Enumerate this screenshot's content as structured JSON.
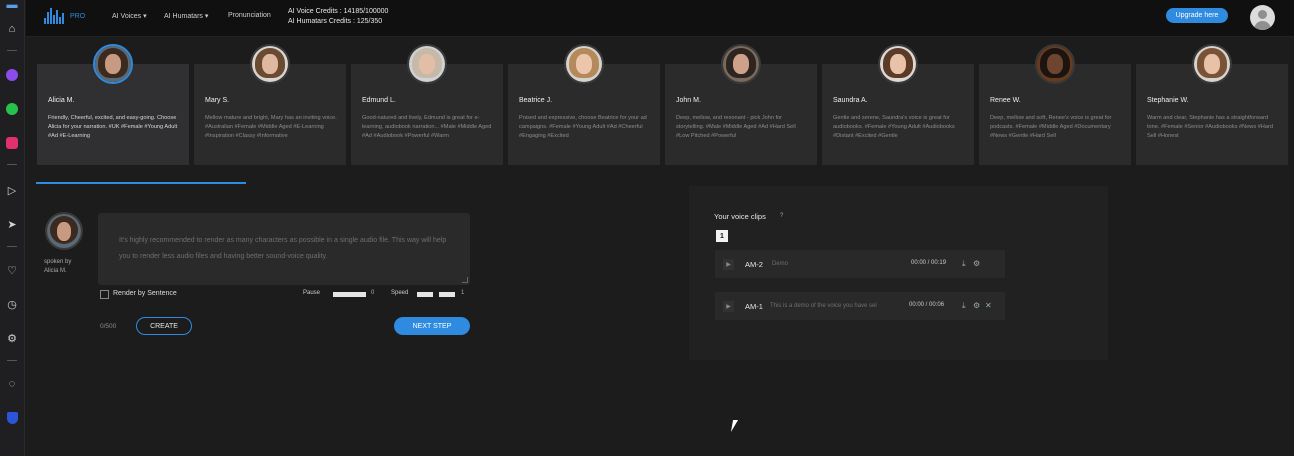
{
  "dock": {
    "icons": [
      "home-icon",
      "messenger-icon",
      "whatsapp-icon",
      "instagram-icon",
      "play-circle-icon",
      "send-icon",
      "heart-icon",
      "clock-icon",
      "gear-icon",
      "lightbulb-icon",
      "shield-icon"
    ]
  },
  "header": {
    "logo_text": "PRO",
    "nav": [
      "AI Voices ▾",
      "AI Humatars ▾",
      "Pronunciation"
    ],
    "credits": {
      "voice": "AI Voice Credits : 14185/100000",
      "humatars": "AI Humatars Credits : 125/350"
    },
    "upgrade_label": "Upgrade here"
  },
  "voices": [
    {
      "name": "Alicia M.",
      "desc": "Friendly, Cheerful, excited, and easy-going. Choose Alicia for your narration. #UK #Female #Young Adult #Ad #E-Learning",
      "selected": true
    },
    {
      "name": "Mary S.",
      "desc": "Mellow mature and bright, Mary has an inviting voice. #Australian #Female #Middle Aged #E-Learning #Inspiration #Classy #Informative",
      "selected": false
    },
    {
      "name": "Edmund L.",
      "desc": "Good-natured and lively, Edmund is great for e-learning, audiobook narration... #Male #Middle Aged #Ad #Audiobook #Powerful #Warm",
      "selected": false
    },
    {
      "name": "Beatrice J.",
      "desc": "Poised and expressive, choose Beatrice for your ad campaigns. #Female #Young Adult #Ad #Cheerful #Engaging #Excited",
      "selected": false
    },
    {
      "name": "John M.",
      "desc": "Deep, mellow, and resonant - pick John for storytelling. #Male #Middle Aged #Ad #Hard Sell #Low Pitched #Powerful",
      "selected": false
    },
    {
      "name": "Saundra A.",
      "desc": "Gentle and serene, Saundra's voice is great for audiobooks. #Female #Young Adult #Audiobooks #Distant #Excited #Gentle",
      "selected": false
    },
    {
      "name": "Renee W.",
      "desc": "Deep, mellow and soft, Renee's voice is great for podcasts. #Female #Middle Aged #Documentary #News #Gentle #Hard Sell",
      "selected": false
    },
    {
      "name": "Stephanie W.",
      "desc": "Warm and clear, Stephanie has a straightforward tone. #Female #Senior #Audiobooks #News #Hard Sell #Honest",
      "selected": false
    }
  ],
  "editor": {
    "spoken_by": "spoken by",
    "speaker": "Alicia M.",
    "placeholder": "It's highly recommended to render as many characters as possible in a single audio file. This way will help you to render less audio files and having better sound-voice quality.",
    "render_by_sentence": "Render by Sentence",
    "pause_label": "Pause",
    "pause_value": "0",
    "speed_label": "Speed",
    "speed_value": "1",
    "counter": "0/500",
    "create_label": "CREATE",
    "next_label": "NEXT STEP"
  },
  "clips_panel": {
    "title": "Your voice clips",
    "help": "?",
    "page": "1",
    "clips": [
      {
        "name": "AM-2",
        "desc": "Demo",
        "time": "00:00 / 00:19"
      },
      {
        "name": "AM-1",
        "desc": "This is a demo of the voice you have sel",
        "time": "00:00 / 00:06"
      }
    ]
  },
  "colors": {
    "accent": "#2f8be0",
    "background": "#1c1c1d",
    "topbar": "#101011",
    "card": "#2b2b2c"
  }
}
